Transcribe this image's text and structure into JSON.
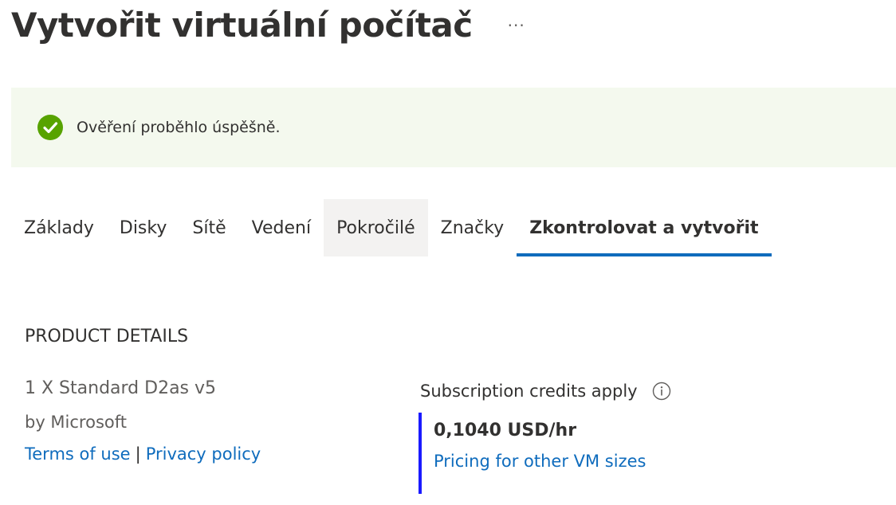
{
  "header": {
    "title": "Vytvořit virtuální počítač",
    "more_label": "···"
  },
  "banner": {
    "icon": "check-circle-icon",
    "message": "Ověření proběhlo úspěšně.",
    "color": "#57a300"
  },
  "tabs": [
    {
      "label": "Základy"
    },
    {
      "label": "Disky"
    },
    {
      "label": "Sítě"
    },
    {
      "label": "Vedení"
    },
    {
      "label": "Pokročilé"
    },
    {
      "label": "Značky"
    },
    {
      "label": "Zkontrolovat a vytvořit"
    }
  ],
  "tabs_state": {
    "active": "Zkontrolovat a vytvořit",
    "hovered": "Pokročilé"
  },
  "product": {
    "heading": "PRODUCT DETAILS",
    "name": "1 X Standard D2as v5",
    "vendor": "by Microsoft",
    "terms_link": "Terms of use",
    "separator": "|",
    "privacy_link": "Privacy policy"
  },
  "pricing": {
    "credits_label": "Subscription credits apply",
    "info_icon": "info-icon",
    "price": "0,1040 USD/hr",
    "other_sizes_link": "Pricing for other VM sizes"
  },
  "colors": {
    "accent": "#0f6cbd",
    "success": "#57a300",
    "price_bar": "#1a1aff",
    "banner_bg": "#f4f9ee"
  }
}
